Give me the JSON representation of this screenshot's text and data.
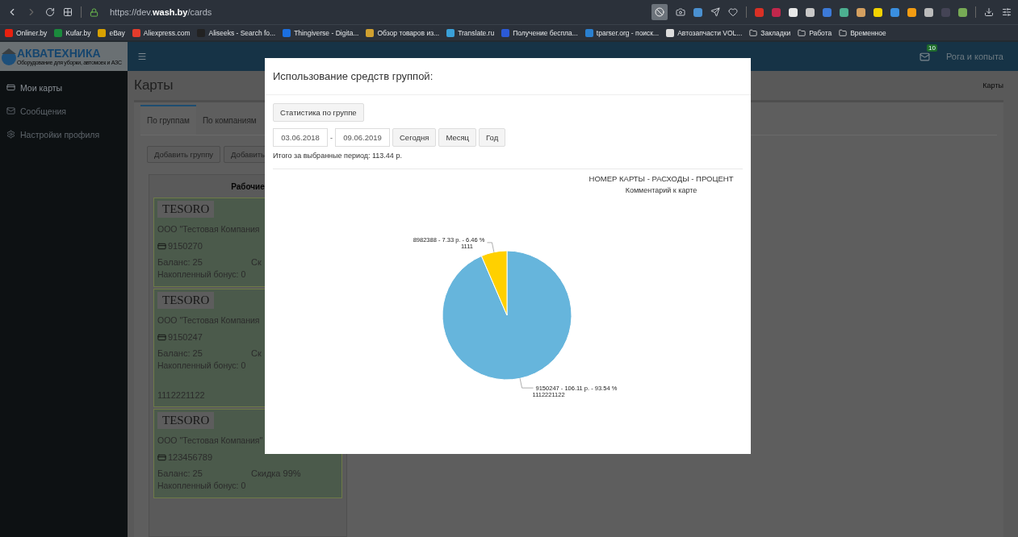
{
  "browser": {
    "url_prefix": "https://dev.",
    "url_domain": "wash.by",
    "url_path": "/cards",
    "bookmarks": [
      {
        "kind": "site",
        "label": "Onliner.by"
      },
      {
        "kind": "site",
        "label": "Kufar.by"
      },
      {
        "kind": "site",
        "label": "eBay"
      },
      {
        "kind": "site",
        "label": "Aliexpress.com"
      },
      {
        "kind": "site",
        "label": "Aliseeks - Search fo..."
      },
      {
        "kind": "site",
        "label": "Thingiverse - Digita..."
      },
      {
        "kind": "site",
        "label": "Обзор товаров из..."
      },
      {
        "kind": "site",
        "label": "Translate.ru"
      },
      {
        "kind": "site",
        "label": "Получение бесплa..."
      },
      {
        "kind": "site",
        "label": "tparser.org - поиск..."
      },
      {
        "kind": "site",
        "label": "Автозапчасти VOL..."
      },
      {
        "kind": "folder",
        "label": "Закладки"
      },
      {
        "kind": "folder",
        "label": "Работа"
      },
      {
        "kind": "folder",
        "label": "Временное"
      }
    ]
  },
  "app": {
    "logo": "АКВАТЕХНИКА",
    "logo_tagline": "Оборудование для уборки, автомоек и АЗС",
    "mail_badge": "10",
    "user": "Рога и копыта"
  },
  "sidebar": {
    "items": [
      {
        "label": "Мои карты",
        "kind": "card",
        "selected": true
      },
      {
        "label": "Сообщения",
        "kind": "mail",
        "selected": false
      },
      {
        "label": "Настройки профиля",
        "kind": "gears",
        "selected": false
      }
    ]
  },
  "page": {
    "title": "Карты",
    "breadcrumb": "Карты",
    "tabs": [
      {
        "label": "По группам",
        "selected": true
      },
      {
        "label": "По компаниям",
        "selected": false
      }
    ],
    "buttons": [
      "Добавить группу",
      "Добавить"
    ],
    "group": {
      "title": "Рабочие",
      "cards": [
        {
          "logo": "TESORO",
          "company": "ООО \"Тестовая Компания",
          "number": "9150270",
          "balance": "Баланс: 25",
          "discount": "Ск",
          "bonus": "Накопленный бонус: 0"
        },
        {
          "logo": "TESORO",
          "company": "ООО \"Тестовая Компания",
          "number": "9150247",
          "balance": "Баланс: 25",
          "discount": "Ск",
          "bonus": "Накопленный бонус: 0",
          "comment": "1112221122"
        },
        {
          "logo": "TESORO",
          "company": "ООО \"Тестовая Компания\"",
          "number": "123456789",
          "balance": "Баланс: 25",
          "discount": "Скидка 99%",
          "bonus": "Накопленный бонус: 0"
        }
      ]
    }
  },
  "modal": {
    "title": "Использование средств группой:",
    "stats_button": "Статистика по группе",
    "date_from": "03.06.2018",
    "date_sep": "-",
    "date_to": "09.06.2019",
    "period_buttons": [
      "Сегодня",
      "Месяц",
      "Год"
    ],
    "total": "Итого за выбранные период: 113.44 р.",
    "subtitle": "Комментарий к карте",
    "slice_comments": [
      "1112221122",
      "1111"
    ],
    "chart_data": {
      "type": "pie",
      "title": "НОМЕР КАРТЫ - РАСХОДЫ - ПРОЦЕНТ",
      "categories": [
        "9150247 - 106.11 р. - 93.54 %",
        "8982388 - 7.33 р. - 6.46 %"
      ],
      "values": [
        93.54,
        6.46
      ],
      "colors": [
        "#66b5dc",
        "#ffd000"
      ]
    }
  }
}
